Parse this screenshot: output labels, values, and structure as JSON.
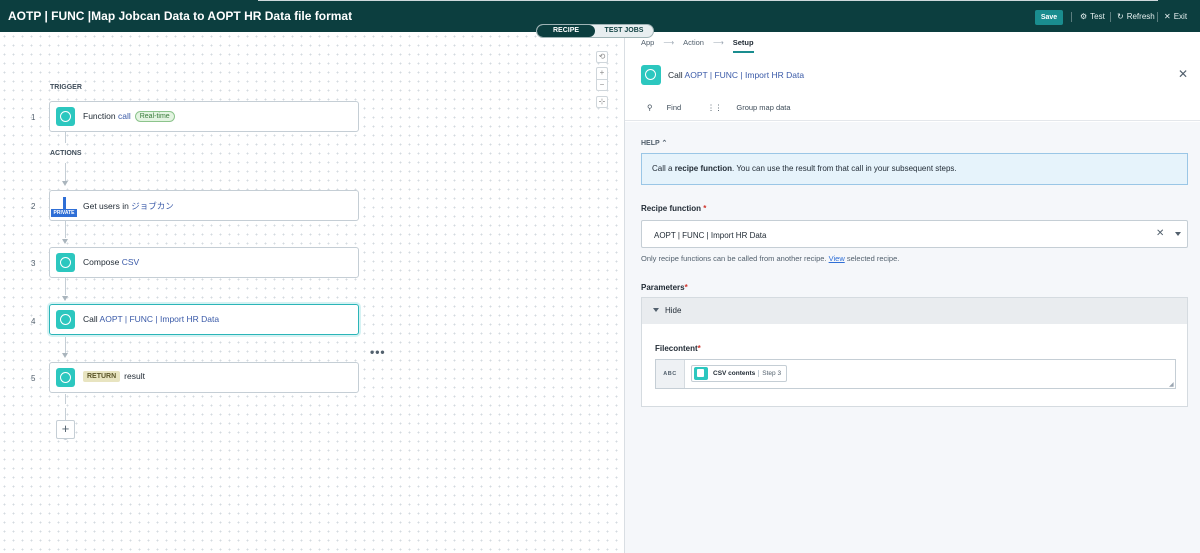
{
  "header": {
    "title": "AOTP | FUNC |Map Jobcan Data to AOPT HR Data file format",
    "save": "Save",
    "test": "Test",
    "refresh": "Refresh",
    "exit": "Exit"
  },
  "mode_toggle": {
    "recipe": "RECIPE",
    "test_jobs": "TEST JOBS"
  },
  "canvas": {
    "zoom": {
      "reset": "⟲",
      "plus": "+",
      "minus": "−"
    },
    "trigger_label": "TRIGGER",
    "actions_label": "ACTIONS",
    "steps": [
      {
        "num": "1",
        "prefix": "Function ",
        "link": "call",
        "badge": "Real-time"
      },
      {
        "num": "2",
        "prefix": "Get users in ",
        "link": "ジョブカン",
        "private": "PRIVATE"
      },
      {
        "num": "3",
        "prefix": "Compose ",
        "link": "CSV"
      },
      {
        "num": "4",
        "prefix": "Call ",
        "link": "AOPT | FUNC | Import HR Data"
      },
      {
        "num": "5",
        "return": "RETURN",
        "suffix": "result"
      }
    ],
    "more": "•••",
    "add": "+"
  },
  "panel": {
    "breadcrumb": [
      "App",
      "Action",
      "Setup"
    ],
    "title_prefix": "Call ",
    "title_link": "AOPT | FUNC | Import HR Data",
    "close": "✕",
    "find": "Find",
    "group_map": "Group map data",
    "help_label": "HELP",
    "help_pre": "Call a ",
    "help_bold": "recipe function",
    "help_post": ". You can use the result from that call in your subsequent steps.",
    "recipe_function_label": "Recipe function",
    "recipe_function_value": "AOPT | FUNC | Import HR Data",
    "hint_pre": "Only recipe functions can be called from another recipe. ",
    "hint_link": "View",
    "hint_post": " selected recipe.",
    "parameters_label": "Parameters",
    "hide_label": "Hide",
    "filecontent_label": "Filecontent",
    "abc": "ABC",
    "pill_label": "CSV contents",
    "pill_step": "Step 3",
    "required": "*"
  }
}
